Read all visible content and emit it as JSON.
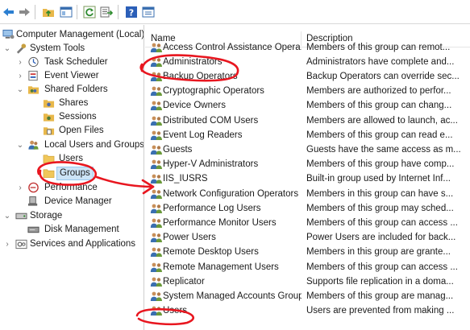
{
  "toolbar": {
    "buttons": [
      "back-icon",
      "forward-icon",
      "up-folder-icon",
      "show-hide-tree-icon",
      "refresh-icon",
      "export-list-icon",
      "help-icon",
      "properties-icon"
    ]
  },
  "tree": {
    "root": "Computer Management (Local)",
    "system_tools": "System Tools",
    "task_scheduler": "Task Scheduler",
    "event_viewer": "Event Viewer",
    "shared_folders": "Shared Folders",
    "shares": "Shares",
    "sessions": "Sessions",
    "open_files": "Open Files",
    "local_users_groups": "Local Users and Groups",
    "users": "Users",
    "groups": "Groups",
    "performance": "Performance",
    "device_manager": "Device Manager",
    "storage": "Storage",
    "disk_management": "Disk Management",
    "services_apps": "Services and Applications"
  },
  "list": {
    "columns": {
      "name": "Name",
      "description": "Description"
    },
    "rows": [
      {
        "name": "Access Control Assistance Opera...",
        "description": "Members of this group can remot..."
      },
      {
        "name": "Administrators",
        "description": "Administrators have complete and..."
      },
      {
        "name": "Backup Operators",
        "description": "Backup Operators can override sec..."
      },
      {
        "name": "Cryptographic Operators",
        "description": "Members are authorized to perfor..."
      },
      {
        "name": "Device Owners",
        "description": "Members of this group can chang..."
      },
      {
        "name": "Distributed COM Users",
        "description": "Members are allowed to launch, ac..."
      },
      {
        "name": "Event Log Readers",
        "description": "Members of this group can read e..."
      },
      {
        "name": "Guests",
        "description": "Guests have the same access as m..."
      },
      {
        "name": "Hyper-V Administrators",
        "description": "Members of this group have comp..."
      },
      {
        "name": "IIS_IUSRS",
        "description": "Built-in group used by Internet Inf..."
      },
      {
        "name": "Network Configuration Operators",
        "description": "Members in this group can have s..."
      },
      {
        "name": "Performance Log Users",
        "description": "Members of this group may sched..."
      },
      {
        "name": "Performance Monitor Users",
        "description": "Members of this group can access ..."
      },
      {
        "name": "Power Users",
        "description": "Power Users are included for back..."
      },
      {
        "name": "Remote Desktop Users",
        "description": "Members in this group are grante..."
      },
      {
        "name": "Remote Management Users",
        "description": "Members of this group can access ..."
      },
      {
        "name": "Replicator",
        "description": "Supports file replication in a doma..."
      },
      {
        "name": "System Managed Accounts Group",
        "description": "Members of this group are manag..."
      },
      {
        "name": "Users",
        "description": "Users are prevented from making ..."
      }
    ]
  },
  "colors": {
    "annotation": "#e8161f",
    "selection_bg": "#cce4f7",
    "selection_border": "#99c9ef"
  }
}
